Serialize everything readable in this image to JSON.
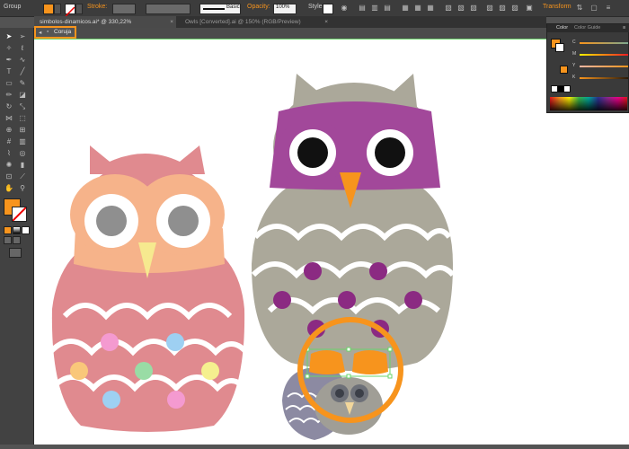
{
  "control_bar": {
    "selection_label": "Group",
    "stroke_label": "Stroke:",
    "brush_label": "Basic",
    "opacity_label": "Opacity:",
    "opacity_value": "100%",
    "style_label": "Style:",
    "transform_label": "Transform",
    "fill_color": "#f7941d"
  },
  "tabs": [
    {
      "label": "simbolos-dinamicos.ai* @ 330,22% (CMYK/Preview)",
      "active": true
    },
    {
      "label": "Owls [Converted].ai @ 150% (RGB/Preview)",
      "active": false
    }
  ],
  "isolation": {
    "label": "Coruja"
  },
  "color_panel": {
    "tab_color": "Color",
    "tab_guide": "Color Guide",
    "channels": [
      {
        "key": "C",
        "value": 0
      },
      {
        "key": "M",
        "value": 50
      },
      {
        "key": "Y",
        "value": 100
      },
      {
        "key": "K",
        "value": 0
      }
    ]
  },
  "colors": {
    "accent_orange": "#f7941d",
    "pink_owl_body": "#e08a8f",
    "pink_owl_face": "#f6b38a",
    "gray_owl_body": "#aba89a",
    "purple_mask": "#a2489a",
    "purple_dots": "#8b2a82",
    "isolation_line": "#6bd56b"
  },
  "icons": {
    "tool_icons": [
      "selection-icon",
      "direct-selection-icon",
      "magic-wand-icon",
      "lasso-icon",
      "pen-icon",
      "curvature-icon",
      "type-icon",
      "line-icon",
      "rectangle-icon",
      "paintbrush-icon",
      "pencil-icon",
      "eraser-icon",
      "rotate-icon",
      "scale-icon",
      "width-icon",
      "free-transform-icon",
      "shape-builder-icon",
      "perspective-icon",
      "mesh-icon",
      "gradient-icon",
      "eyedropper-icon",
      "blend-icon",
      "symbol-sprayer-icon",
      "column-graph-icon",
      "artboard-icon",
      "slice-icon",
      "hand-icon",
      "zoom-icon"
    ]
  }
}
